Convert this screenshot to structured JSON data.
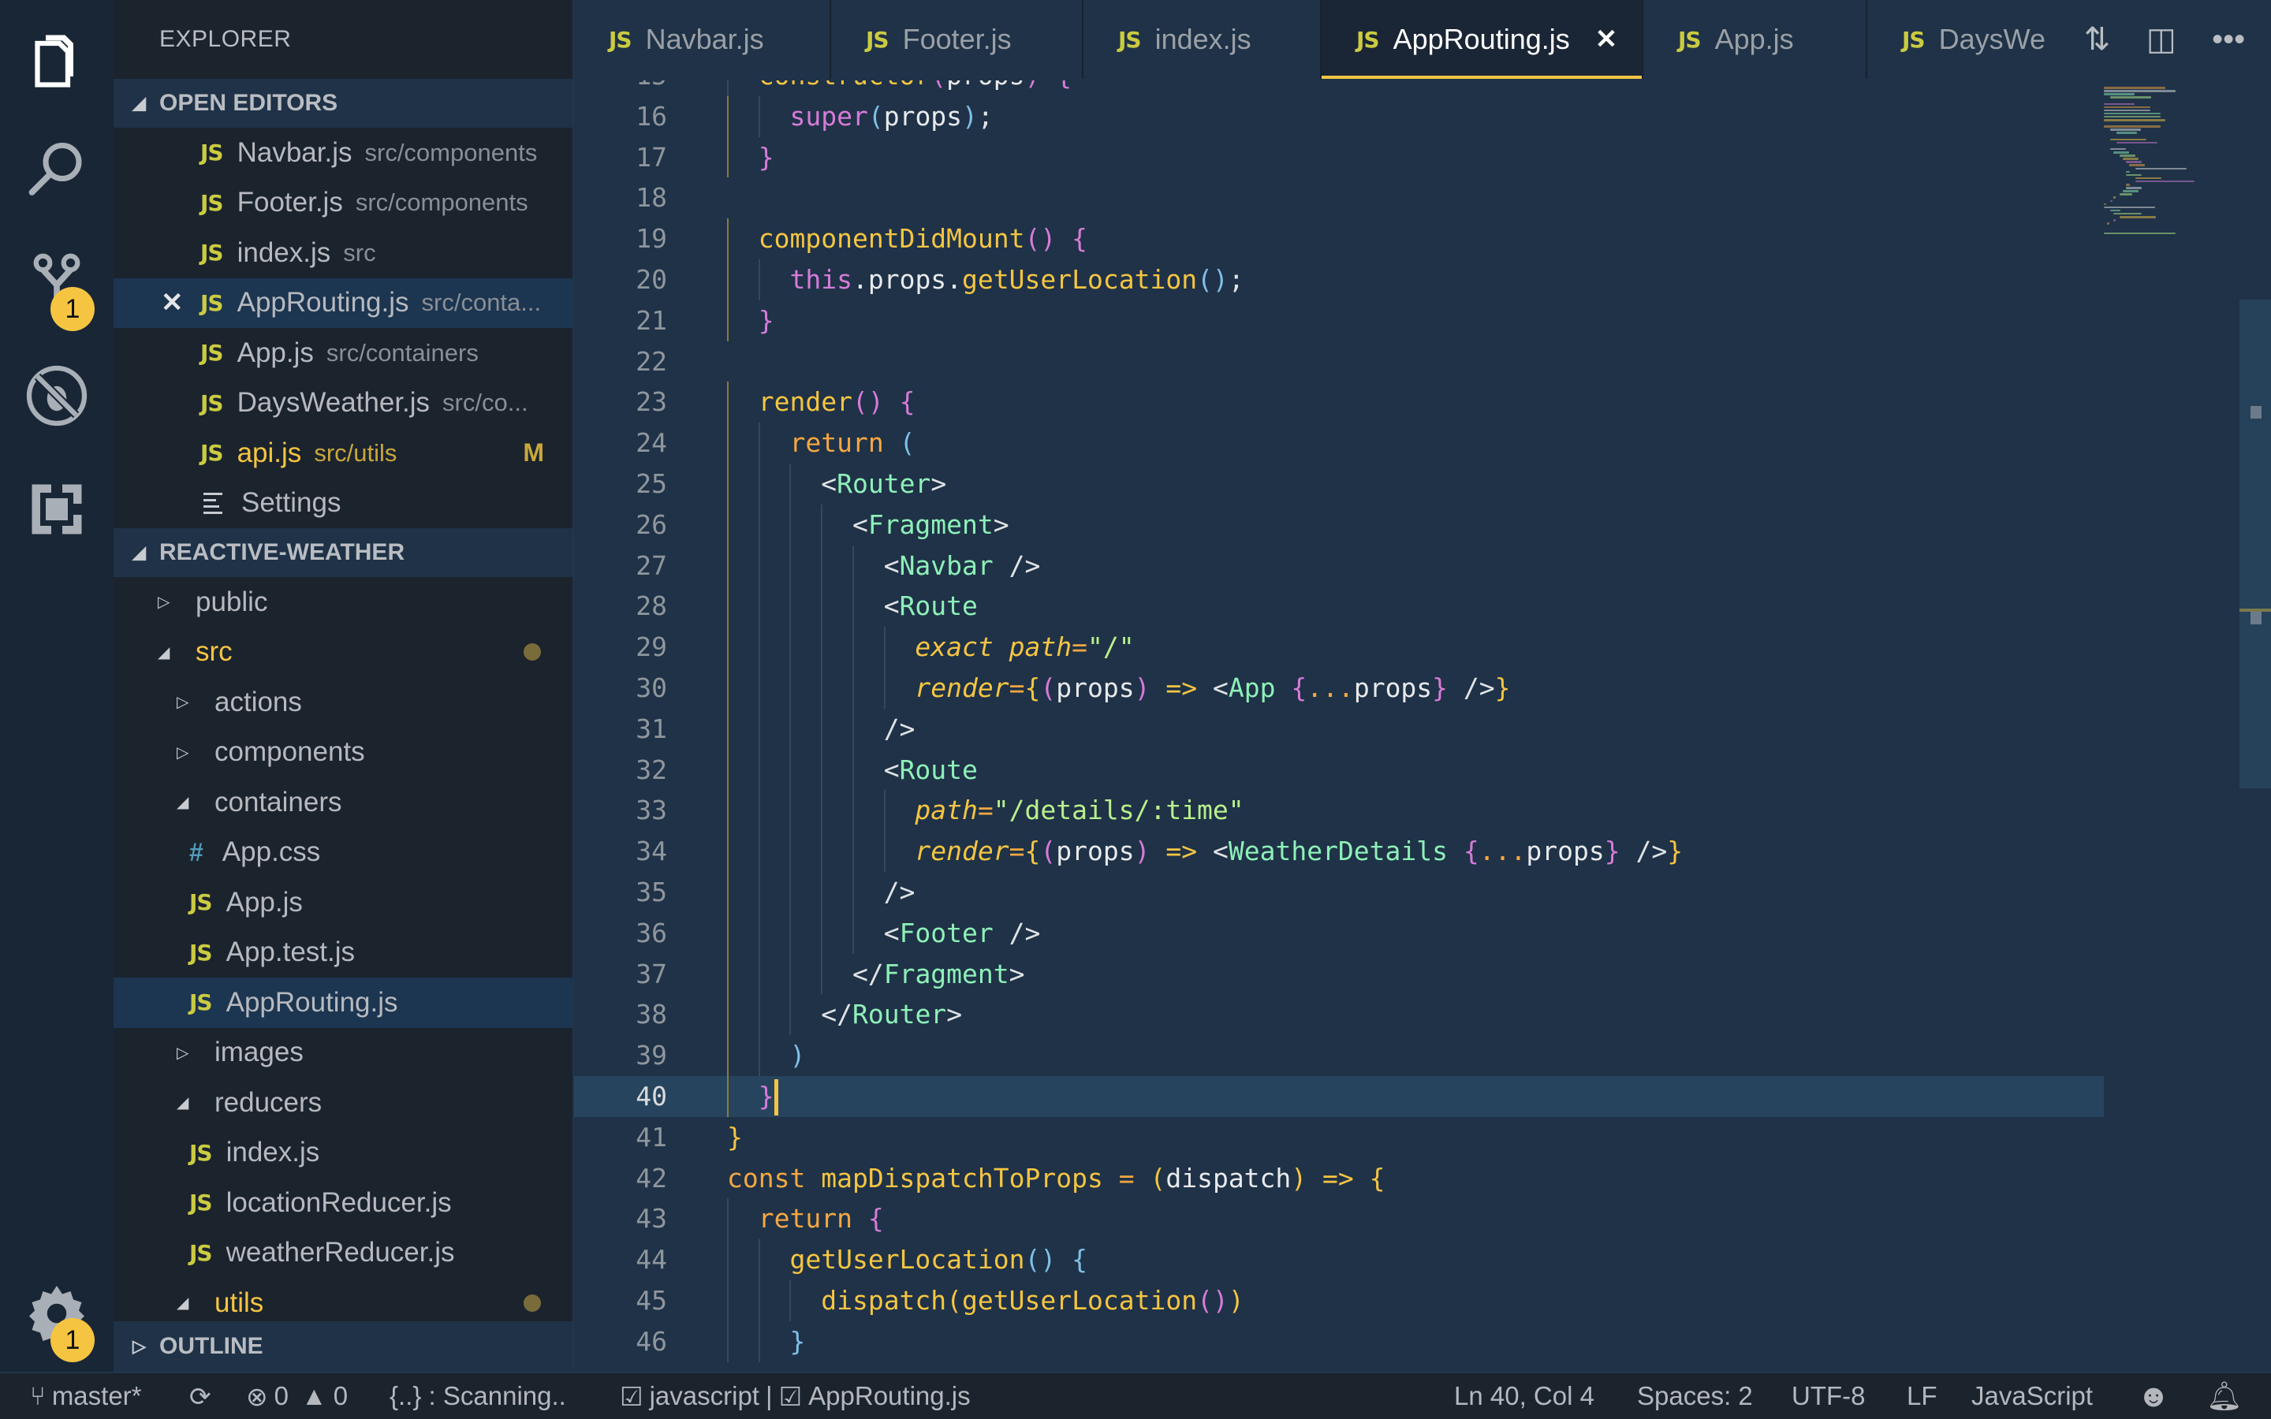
{
  "activity_bar": {
    "items": [
      {
        "name": "explorer",
        "icon": "files-icon",
        "active": true
      },
      {
        "name": "search",
        "icon": "search-icon"
      },
      {
        "name": "source-control",
        "icon": "source-control-icon",
        "badge": "1"
      },
      {
        "name": "debug",
        "icon": "debug-icon"
      },
      {
        "name": "extensions",
        "icon": "extensions-icon"
      }
    ],
    "settings_badge": "1"
  },
  "sidebar": {
    "title": "EXPLORER",
    "open_editors": {
      "label": "OPEN EDITORS",
      "items": [
        {
          "name": "Navbar.js",
          "desc": "src/components",
          "type": "js"
        },
        {
          "name": "Footer.js",
          "desc": "src/components",
          "type": "js"
        },
        {
          "name": "index.js",
          "desc": "src",
          "type": "js"
        },
        {
          "name": "AppRouting.js",
          "desc": "src/conta...",
          "type": "js",
          "selected": true,
          "close": "✕"
        },
        {
          "name": "App.js",
          "desc": "src/containers",
          "type": "js"
        },
        {
          "name": "DaysWeather.js",
          "desc": "src/co...",
          "type": "js"
        },
        {
          "name": "api.js",
          "desc": "src/utils",
          "type": "js",
          "status": "M"
        },
        {
          "name": "Settings",
          "desc": "",
          "type": "settings"
        }
      ]
    },
    "project": {
      "label": "REACTIVE-WEATHER",
      "tree": [
        {
          "name": "public",
          "kind": "folder",
          "expanded": false,
          "depth": 0
        },
        {
          "name": "src",
          "kind": "folder",
          "expanded": true,
          "depth": 0,
          "modified": true
        },
        {
          "name": "actions",
          "kind": "folder",
          "expanded": false,
          "depth": 1
        },
        {
          "name": "components",
          "kind": "folder",
          "expanded": false,
          "depth": 1
        },
        {
          "name": "containers",
          "kind": "folder",
          "expanded": true,
          "depth": 1
        },
        {
          "name": "App.css",
          "kind": "css",
          "depth": 2
        },
        {
          "name": "App.js",
          "kind": "js",
          "depth": 2
        },
        {
          "name": "App.test.js",
          "kind": "js",
          "depth": 2
        },
        {
          "name": "AppRouting.js",
          "kind": "js",
          "depth": 2,
          "selected": true
        },
        {
          "name": "images",
          "kind": "folder",
          "expanded": false,
          "depth": 1
        },
        {
          "name": "reducers",
          "kind": "folder",
          "expanded": true,
          "depth": 1
        },
        {
          "name": "index.js",
          "kind": "js",
          "depth": 2
        },
        {
          "name": "locationReducer.js",
          "kind": "js",
          "depth": 2
        },
        {
          "name": "weatherReducer.js",
          "kind": "js",
          "depth": 2
        },
        {
          "name": "utils",
          "kind": "folder",
          "expanded": true,
          "depth": 1,
          "modified": true
        }
      ]
    },
    "outline_label": "OUTLINE"
  },
  "tabs": [
    {
      "label": "Navbar.js"
    },
    {
      "label": "Footer.js"
    },
    {
      "label": "index.js"
    },
    {
      "label": "AppRouting.js",
      "active": true,
      "close": "✕"
    },
    {
      "label": "App.js"
    },
    {
      "label": "DaysWe"
    }
  ],
  "tab_actions": [
    "compare-changes-icon",
    "split-editor-icon",
    "more-actions-icon"
  ],
  "editor": {
    "first_line": 15,
    "current_line": 40,
    "lines": [
      [
        [
          "  ",
          ""
        ],
        [
          "constructor",
          "fn"
        ],
        [
          "(",
          "b2"
        ],
        [
          "props",
          "pr"
        ],
        [
          ")",
          "b2"
        ],
        [
          " ",
          ""
        ],
        [
          "{",
          "b2"
        ]
      ],
      [
        [
          "    ",
          ""
        ],
        [
          "super",
          "sup"
        ],
        [
          "(",
          "b3"
        ],
        [
          "props",
          "pr"
        ],
        [
          ")",
          "b3"
        ],
        [
          ";",
          "pn"
        ]
      ],
      [
        [
          "  ",
          ""
        ],
        [
          "}",
          "b2"
        ]
      ],
      [],
      [
        [
          "  ",
          ""
        ],
        [
          "componentDidMount",
          "fn"
        ],
        [
          "()",
          "b2"
        ],
        [
          " ",
          ""
        ],
        [
          "{",
          "b2"
        ]
      ],
      [
        [
          "    ",
          ""
        ],
        [
          "this",
          "this"
        ],
        [
          ".props.",
          "pr"
        ],
        [
          "getUserLocation",
          "fn"
        ],
        [
          "()",
          "b3"
        ],
        [
          ";",
          "pn"
        ]
      ],
      [
        [
          "  ",
          ""
        ],
        [
          "}",
          "b2"
        ]
      ],
      [],
      [
        [
          "  ",
          ""
        ],
        [
          "render",
          "fn"
        ],
        [
          "()",
          "b2"
        ],
        [
          " ",
          ""
        ],
        [
          "{",
          "b2"
        ]
      ],
      [
        [
          "    ",
          ""
        ],
        [
          "return",
          "kw"
        ],
        [
          " ",
          ""
        ],
        [
          "(",
          "b3"
        ]
      ],
      [
        [
          "      ",
          ""
        ],
        [
          "<",
          "pn"
        ],
        [
          "Router",
          "tag"
        ],
        [
          ">",
          "pn"
        ]
      ],
      [
        [
          "        ",
          ""
        ],
        [
          "<",
          "pn"
        ],
        [
          "Fragment",
          "tag"
        ],
        [
          ">",
          "pn"
        ]
      ],
      [
        [
          "          ",
          ""
        ],
        [
          "<",
          "pn"
        ],
        [
          "Navbar",
          "tag"
        ],
        [
          " />",
          "pn"
        ]
      ],
      [
        [
          "          ",
          ""
        ],
        [
          "<",
          "pn"
        ],
        [
          "Route",
          "tag"
        ]
      ],
      [
        [
          "            ",
          ""
        ],
        [
          "exact",
          "attr"
        ],
        [
          " ",
          ""
        ],
        [
          "path",
          "attr"
        ],
        [
          "=",
          "op"
        ],
        [
          "\"/\"",
          "str"
        ]
      ],
      [
        [
          "            ",
          ""
        ],
        [
          "render",
          "attr"
        ],
        [
          "=",
          "op"
        ],
        [
          "{",
          "b1"
        ],
        [
          "(",
          "b2"
        ],
        [
          "props",
          "pr"
        ],
        [
          ")",
          "b2"
        ],
        [
          " ",
          ""
        ],
        [
          "=>",
          "b1"
        ],
        [
          " <",
          "pn"
        ],
        [
          "App",
          "tag"
        ],
        [
          " ",
          ""
        ],
        [
          "{",
          "b2"
        ],
        [
          "...",
          "op"
        ],
        [
          "props",
          "pr"
        ],
        [
          "}",
          "b2"
        ],
        [
          " />",
          "pn"
        ],
        [
          "}",
          "b1"
        ]
      ],
      [
        [
          "          ",
          ""
        ],
        [
          "/>",
          "pn"
        ]
      ],
      [
        [
          "          ",
          ""
        ],
        [
          "<",
          "pn"
        ],
        [
          "Route",
          "tag"
        ]
      ],
      [
        [
          "            ",
          ""
        ],
        [
          "path",
          "attr"
        ],
        [
          "=",
          "op"
        ],
        [
          "\"/details/:time\"",
          "str"
        ]
      ],
      [
        [
          "            ",
          ""
        ],
        [
          "render",
          "attr"
        ],
        [
          "=",
          "op"
        ],
        [
          "{",
          "b1"
        ],
        [
          "(",
          "b2"
        ],
        [
          "props",
          "pr"
        ],
        [
          ")",
          "b2"
        ],
        [
          " ",
          ""
        ],
        [
          "=>",
          "b1"
        ],
        [
          " <",
          "pn"
        ],
        [
          "WeatherDetails",
          "tag"
        ],
        [
          " ",
          ""
        ],
        [
          "{",
          "b2"
        ],
        [
          "...",
          "op"
        ],
        [
          "props",
          "pr"
        ],
        [
          "}",
          "b2"
        ],
        [
          " />",
          "pn"
        ],
        [
          "}",
          "b1"
        ]
      ],
      [
        [
          "          ",
          ""
        ],
        [
          "/>",
          "pn"
        ]
      ],
      [
        [
          "          ",
          ""
        ],
        [
          "<",
          "pn"
        ],
        [
          "Footer",
          "tag"
        ],
        [
          " />",
          "pn"
        ]
      ],
      [
        [
          "        ",
          ""
        ],
        [
          "</",
          "pn"
        ],
        [
          "Fragment",
          "tag"
        ],
        [
          ">",
          "pn"
        ]
      ],
      [
        [
          "      ",
          ""
        ],
        [
          "</",
          "pn"
        ],
        [
          "Router",
          "tag"
        ],
        [
          ">",
          "pn"
        ]
      ],
      [
        [
          "    ",
          ""
        ],
        [
          ")",
          "b3"
        ]
      ],
      [
        [
          "  ",
          ""
        ],
        [
          "}",
          "b2"
        ]
      ],
      [
        [
          "}",
          "b1"
        ]
      ],
      [
        [
          "const",
          "kw"
        ],
        [
          " ",
          ""
        ],
        [
          "mapDispatchToProps",
          "fn"
        ],
        [
          " ",
          ""
        ],
        [
          "=",
          "op"
        ],
        [
          " ",
          ""
        ],
        [
          "(",
          "b1"
        ],
        [
          "dispatch",
          "pr"
        ],
        [
          ")",
          "b1"
        ],
        [
          " ",
          ""
        ],
        [
          "=>",
          "b1"
        ],
        [
          " ",
          ""
        ],
        [
          "{",
          "b1"
        ]
      ],
      [
        [
          "  ",
          ""
        ],
        [
          "return",
          "kw"
        ],
        [
          " ",
          ""
        ],
        [
          "{",
          "b2"
        ]
      ],
      [
        [
          "    ",
          ""
        ],
        [
          "getUserLocation",
          "fn"
        ],
        [
          "()",
          "b3"
        ],
        [
          " ",
          ""
        ],
        [
          "{",
          "b3"
        ]
      ],
      [
        [
          "      ",
          ""
        ],
        [
          "dispatch",
          "fn"
        ],
        [
          "(",
          "b1"
        ],
        [
          "getUserLocation",
          "fn"
        ],
        [
          "()",
          "b2"
        ],
        [
          ")",
          "b1"
        ]
      ],
      [
        [
          "    ",
          ""
        ],
        [
          "}",
          "b3"
        ]
      ]
    ]
  },
  "status_bar": {
    "branch": "master*",
    "errors": "0",
    "warnings": "0",
    "scanning": "{..} : Scanning..",
    "lang_check_1": "javascript",
    "separator": "|",
    "lang_check_2": "AppRouting.js",
    "position": "Ln 40, Col 4",
    "spaces": "Spaces: 2",
    "encoding": "UTF-8",
    "eol": "LF",
    "language": "JavaScript"
  },
  "colors": {
    "accent": "#f5c542",
    "editor_bg": "#1f3247",
    "sidebar_bg": "#1b232d",
    "activity_bg": "#192636"
  }
}
